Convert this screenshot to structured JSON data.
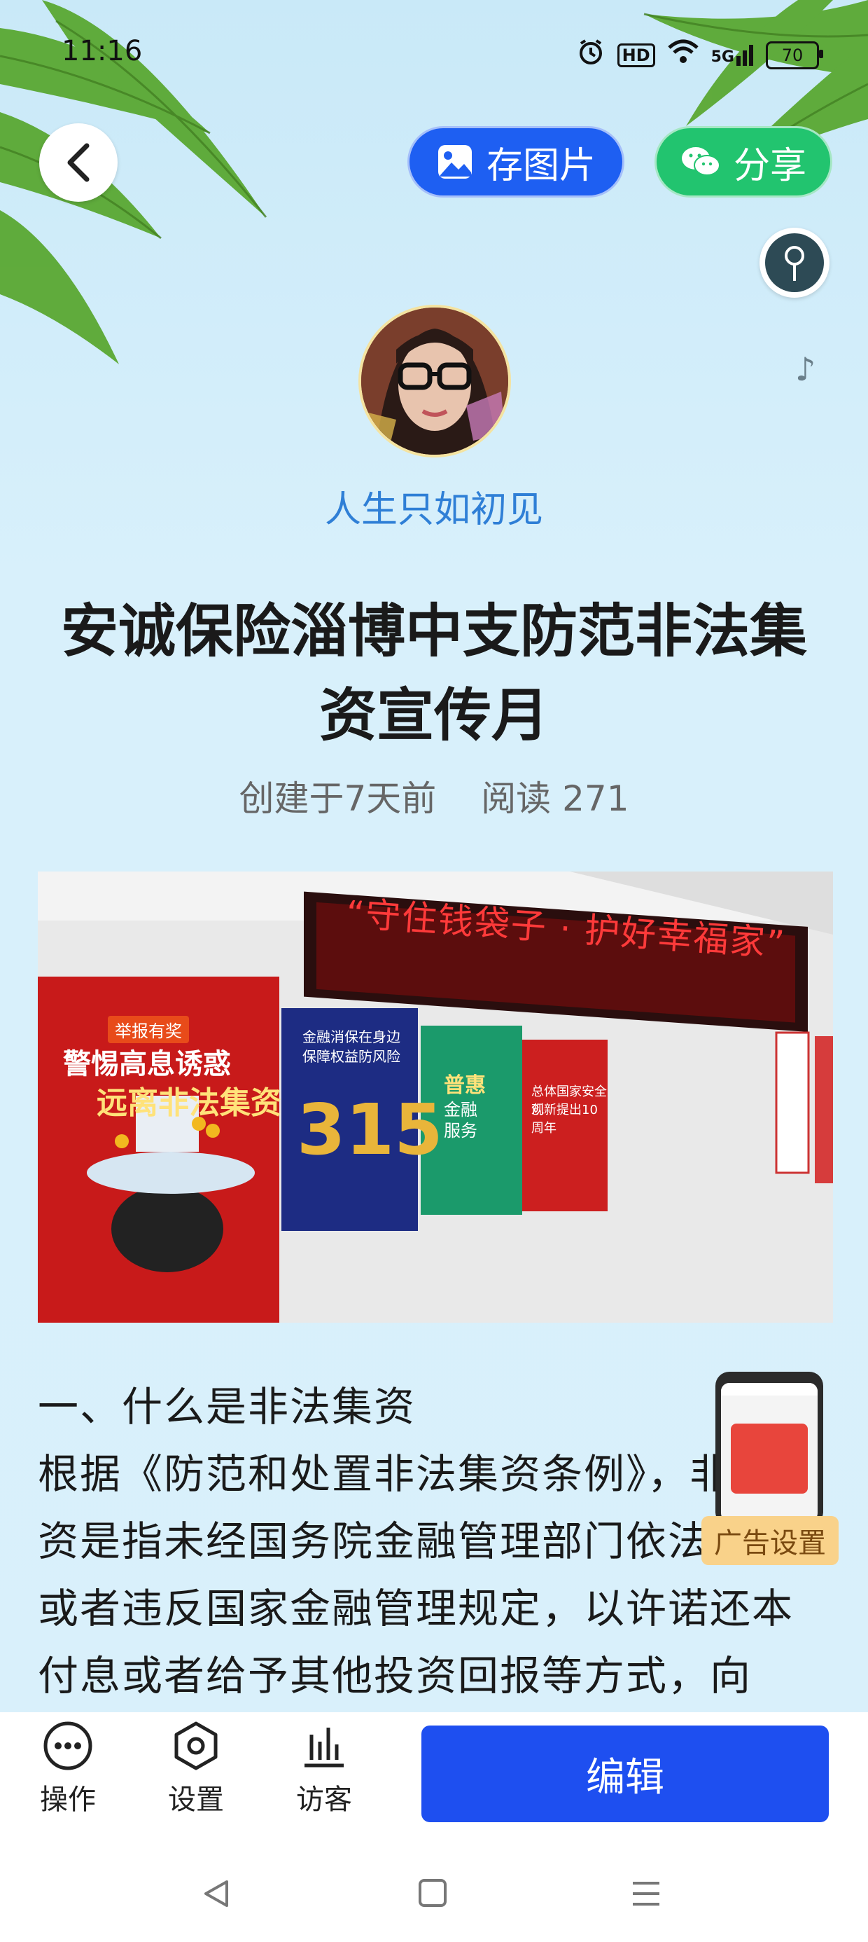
{
  "status_bar": {
    "time": "11:16",
    "hd": "HD",
    "signal": "5G",
    "battery": "70"
  },
  "header": {
    "save_label": "存图片",
    "share_label": "分享"
  },
  "author": {
    "name": "人生只如初见"
  },
  "article": {
    "title": "安诚保险淄博中支防范非法集资宣传月",
    "created": "创建于7天前",
    "reads": "阅读 271",
    "photo": {
      "led_text": "“守住钱袋子 · 护好幸福家”",
      "poster1": {
        "badge": "举报有奖",
        "line1": "警惕高息诱惑",
        "line2": "远离非法集资"
      },
      "poster2": {
        "line1": "金融消保在身边",
        "line2": "保障权益防风险",
        "number": "315"
      },
      "poster3": {
        "line1": "普惠",
        "line2": "金融",
        "line3": "服务"
      },
      "poster4": {
        "line1": "总体国家安全观",
        "line2": "创新提出10周年"
      }
    },
    "paragraphs": [
      "一、什么是非法集资",
      "根据《防范和处置非法集资条例》，非法集资是指未经国务院金融管理部门依法许可或者违反国家金融管理规定，以许诺还本付息或者给予其他投资回报等方式，向"
    ]
  },
  "ad": {
    "label": "广告设置"
  },
  "toolbar": {
    "items": [
      {
        "label": "操作",
        "icon": "more-icon"
      },
      {
        "label": "设置",
        "icon": "settings-icon"
      },
      {
        "label": "访客",
        "icon": "bar-chart-icon"
      }
    ],
    "edit_label": "编辑"
  },
  "colors": {
    "primary": "#1e4ff0",
    "share": "#22c46f",
    "author": "#2f7fd6",
    "background": "#d6eef9"
  }
}
